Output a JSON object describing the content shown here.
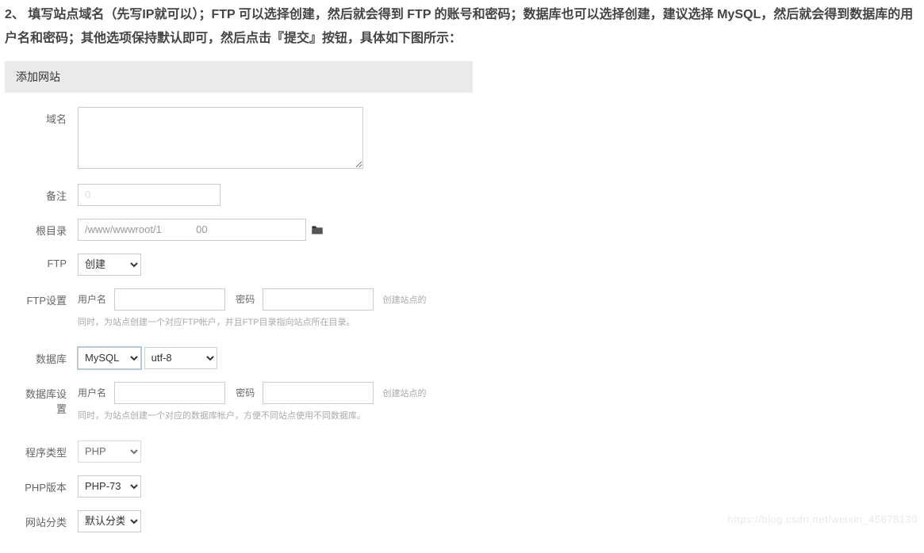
{
  "instruction": "2、 填写站点域名（先写IP就可以）；FTP 可以选择创建，然后就会得到 FTP 的账号和密码；数据库也可以选择创建，建议选择 MySQL，然后就会得到数据库的用户名和密码；其他选项保持默认即可，然后点击『提交』按钮，具体如下图所示：",
  "panel_title": "添加网站",
  "labels": {
    "domain": "域名",
    "remark": "备注",
    "root": "根目录",
    "ftp": "FTP",
    "ftp_setting": "FTP设置",
    "database": "数据库",
    "db_setting": "数据库设置",
    "program": "程序类型",
    "php_ver": "PHP版本",
    "category": "网站分类"
  },
  "inline": {
    "user": "用户名",
    "pwd": "密码"
  },
  "values": {
    "domain_text": "",
    "remark": "0",
    "root_path": "/www/wwwroot/1            00",
    "ftp_sel": "创建",
    "ftp_user": "",
    "ftp_pwd": "",
    "ftp_hint_right": "创建站点的",
    "ftp_hint_below": "同时，为站点创建一个对应FTP帐户，并且FTP目录指向站点所在目录。",
    "db_type": "MySQL",
    "db_charset": "utf-8",
    "db_user": "",
    "db_pwd": "",
    "db_hint_right": "创建站点的",
    "db_hint_below": "同时，为站点创建一个对应的数据库帐户，方便不同站点使用不同数据库。",
    "program": "PHP",
    "php_ver": "PHP-73",
    "category": "默认分类"
  },
  "watermark": "https://blog.csdn.net/weixin_45678130"
}
